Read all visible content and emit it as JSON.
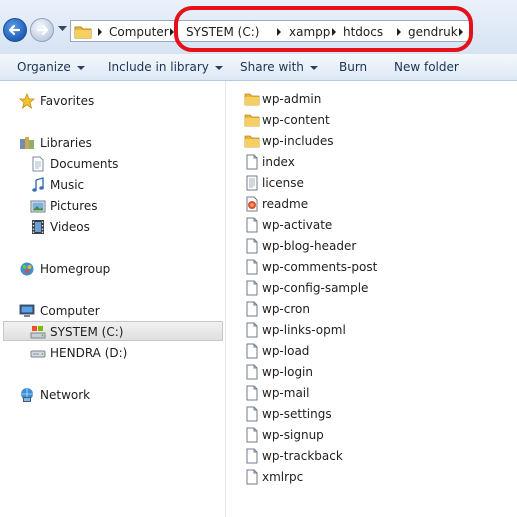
{
  "address_bar": {
    "breadcrumbs": [
      "Computer",
      "SYSTEM (C:)",
      "xampp",
      "htdocs",
      "gendruk"
    ]
  },
  "command_bar": {
    "items": [
      {
        "label": "Organize",
        "has_dropdown": true
      },
      {
        "label": "Include in library",
        "has_dropdown": true
      },
      {
        "label": "Share with",
        "has_dropdown": true
      },
      {
        "label": "Burn",
        "has_dropdown": false
      },
      {
        "label": "New folder",
        "has_dropdown": false
      }
    ]
  },
  "navigation": {
    "favorites": "Favorites",
    "libraries": "Libraries",
    "library_items": [
      "Documents",
      "Music",
      "Pictures",
      "Videos"
    ],
    "homegroup": "Homegroup",
    "computer": "Computer",
    "drives": [
      "SYSTEM (C:)",
      "HENDRA (D:)"
    ],
    "selected_drive": "SYSTEM (C:)",
    "network": "Network"
  },
  "files": [
    {
      "name": "wp-admin",
      "type": "folder"
    },
    {
      "name": "wp-content",
      "type": "folder"
    },
    {
      "name": "wp-includes",
      "type": "folder"
    },
    {
      "name": "index",
      "type": "file"
    },
    {
      "name": "license",
      "type": "text"
    },
    {
      "name": "readme",
      "type": "html"
    },
    {
      "name": "wp-activate",
      "type": "file"
    },
    {
      "name": "wp-blog-header",
      "type": "file"
    },
    {
      "name": "wp-comments-post",
      "type": "file"
    },
    {
      "name": "wp-config-sample",
      "type": "file"
    },
    {
      "name": "wp-cron",
      "type": "file"
    },
    {
      "name": "wp-links-opml",
      "type": "file"
    },
    {
      "name": "wp-load",
      "type": "file"
    },
    {
      "name": "wp-login",
      "type": "file"
    },
    {
      "name": "wp-mail",
      "type": "file"
    },
    {
      "name": "wp-settings",
      "type": "file"
    },
    {
      "name": "wp-signup",
      "type": "file"
    },
    {
      "name": "wp-trackback",
      "type": "file"
    },
    {
      "name": "xmlrpc",
      "type": "file"
    }
  ],
  "colors": {
    "highlight_oval": "#e5101a",
    "address_bar_bg": "#dce7f5",
    "folder_yellow": "#e8b43a"
  }
}
